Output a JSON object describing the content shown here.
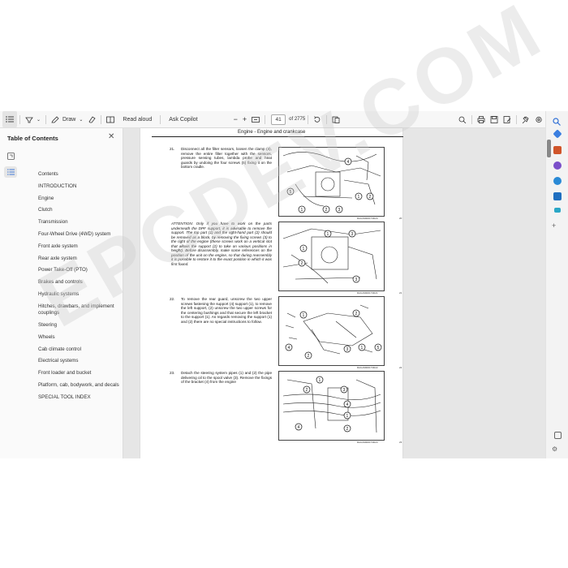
{
  "toolbar": {
    "draw_label": "Draw",
    "read_aloud_label": "Read aloud",
    "ask_copilot_label": "Ask Copilot",
    "zoom_out": "−",
    "zoom_in": "+",
    "page_number": "41",
    "page_total": "of 2775"
  },
  "toc": {
    "title": "Table of Contents",
    "items": [
      "Contents",
      "INTRODUCTION",
      "Engine",
      "Clutch",
      "Transmission",
      "Four-Wheel Drive (4WD) system",
      "Front axle system",
      "Rear axle system",
      "Power Take-Off (PTO)",
      "Brakes and controls",
      "Hydraulic systems",
      "Hitches, drawbars, and implement couplings",
      "Steering",
      "Wheels",
      "Cab climate control",
      "Electrical systems",
      "Front loader and bucket",
      "Platform, cab, bodywork, and decals",
      "SPECIAL TOOL INDEX"
    ]
  },
  "document": {
    "running_header": "Engine - Engine and crankcase",
    "steps": [
      {
        "num": "21.",
        "text": "Disconnect all the filter sensors, loosen the clamp (4), remove the entire filter together with the sensors, pressure sensing tubes, lambda probe and heat guards by undoing the four screws (5) fixing it on the bottom cradle."
      },
      {
        "num": "",
        "text": "ATTENTION: Only if you have to work on the parts underneath the DPF support, it is advisable to remove the support. The top part (1) and the right-hand part (2) should be removed as a block, by removing the fixing screws (3) to the right of the engine (these screws work on a vertical slot that allows the support (2) to take on various positions in height). Before disassembly, make some references on the position of the unit on the engine, so that during reassembly it is possible to restore it to the exact position in which it was first found."
      },
      {
        "num": "22.",
        "text": "To remove the rear guard, unscrew the two upper screws fastening the support (4) support (1), to remove the left support, (2) unscrew the two upper screws for the centering bushings and that secure the left bracket to the support (1). As regards removing the support (1) and (2) there are no special instructions to follow."
      },
      {
        "num": "23.",
        "text": "Detach the steering system pipes (1) and (2) the pipe delivering oil to the spool valve (3). Remove the fixings of the bracket (4) from the engine"
      }
    ],
    "figure_codes": [
      "RAIL49900173D20",
      "RAIL49900173D21",
      "RAIL49900173D22",
      "RAIL49900173D23"
    ],
    "figure_numbers": [
      "20",
      "21",
      "22",
      "23"
    ],
    "callouts": [
      "1",
      "2",
      "3",
      "4",
      "5"
    ]
  },
  "watermark": "EPCDEV.COM",
  "colors": {
    "accent_blue": "#2f6fd6",
    "toolbar_bg": "#f7f7f7",
    "panel_bg": "#fafafa",
    "doc_bg": "#e6e6e6"
  },
  "icons": [
    "list-icon",
    "highlighter-icon",
    "draw-icon",
    "eraser-icon",
    "reading-view-icon",
    "fit-page-icon",
    "rotate-icon",
    "share-icon",
    "search-icon",
    "print-icon",
    "save-icon",
    "save-as-icon",
    "settings-icon",
    "pin-icon",
    "close-icon",
    "bookmark-icon",
    "outline-icon"
  ]
}
